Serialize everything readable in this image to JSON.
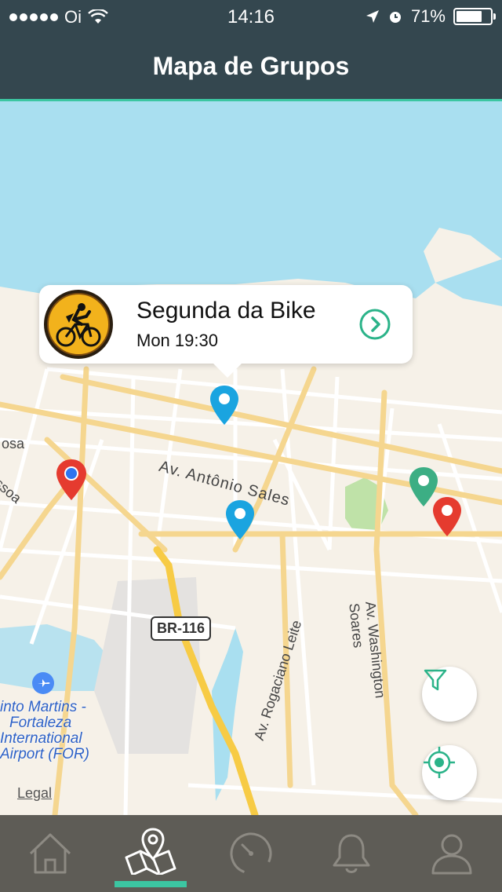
{
  "status_bar": {
    "carrier": "Oi",
    "time": "14:16",
    "battery_percent": "71%",
    "battery_level": 0.71
  },
  "header": {
    "title": "Mapa de Grupos"
  },
  "callout": {
    "group_name": "Segunda da Bike",
    "schedule": "Mon 19:30",
    "icon": "chevron-right-circle-icon"
  },
  "map": {
    "street_labels": {
      "antonio_sales": "Av. Antônio Sales",
      "rogaciano_leite": "Av. Rogaciano Leite",
      "washington_soares": "Av. Washington Soares",
      "br116": "BR-116",
      "left_sosa": "osa",
      "left_ssoa": "ssoa"
    },
    "airport_label": [
      "into Martins -",
      "Fortaleza",
      "International",
      "Airport (FOR)"
    ],
    "legal": "Legal",
    "colors": {
      "water": "#a9dff0",
      "land": "#f6f1e8",
      "road_major": "#f5d68f",
      "park": "#bfe2a8",
      "pin_blue": "#1aa4e0",
      "pin_red": "#e53b2f",
      "pin_green": "#3cae84"
    }
  },
  "buttons": {
    "filter": "filter-icon",
    "locate": "crosshair-icon"
  },
  "tabbar": {
    "tabs": [
      {
        "name": "home",
        "icon": "home-icon",
        "selected": false
      },
      {
        "name": "map",
        "icon": "map-pin-icon",
        "selected": true
      },
      {
        "name": "speed",
        "icon": "speedometer-icon",
        "selected": false
      },
      {
        "name": "notifications",
        "icon": "bell-icon",
        "selected": false
      },
      {
        "name": "profile",
        "icon": "user-icon",
        "selected": false
      }
    ],
    "accent": "#3cc6a2"
  }
}
